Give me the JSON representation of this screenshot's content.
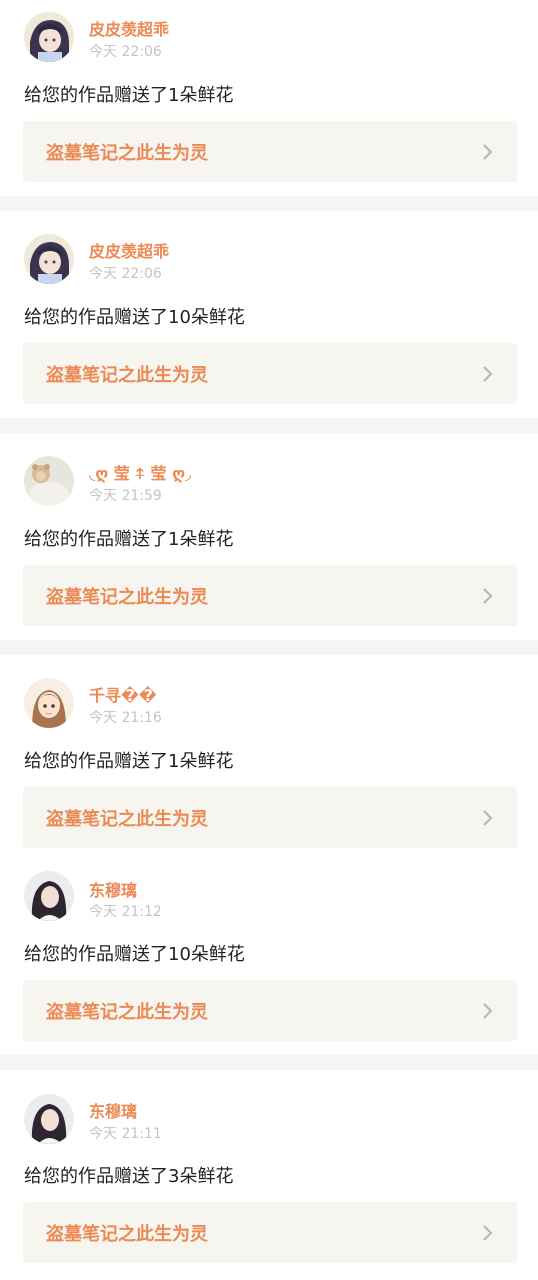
{
  "items": [
    {
      "user_name": "皮皮羡超乖",
      "time": "今天 22:06",
      "message": "给您的作品赠送了1朵鲜花",
      "work_title": "盗墓笔记之此生为灵",
      "avatar": "anime-girl-avatar"
    },
    {
      "user_name": "皮皮羡超乖",
      "time": "今天 22:06",
      "message": "给您的作品赠送了10朵鲜花",
      "work_title": "盗墓笔记之此生为灵",
      "avatar": "anime-girl-avatar"
    },
    {
      "user_name": "◟ღ 莹 ⍏ 莹 ღ◞",
      "time": "今天 21:59",
      "message": "给您的作品赠送了1朵鲜花",
      "work_title": "盗墓笔记之此生为灵",
      "avatar": "teddy-bear-avatar"
    },
    {
      "user_name": "千寻��",
      "time": "今天 21:16",
      "message": "给您的作品赠送了1朵鲜花",
      "work_title": "盗墓笔记之此生为灵",
      "avatar": "cartoon-girl-avatar"
    },
    {
      "user_name": "东穆璃",
      "time": "今天 21:12",
      "message": "给您的作品赠送了10朵鲜花",
      "work_title": "盗墓笔记之此生为灵",
      "avatar": "photo-girl-avatar"
    },
    {
      "user_name": "东穆璃",
      "time": "今天 21:11",
      "message": "给您的作品赠送了3朵鲜花",
      "work_title": "盗墓笔记之此生为灵",
      "avatar": "photo-girl-avatar"
    }
  ],
  "colors": {
    "accent": "#ec8a55",
    "time": "#c4c4c4",
    "card_bg": "#f6f5ef",
    "divider": "#f5f5f5"
  }
}
